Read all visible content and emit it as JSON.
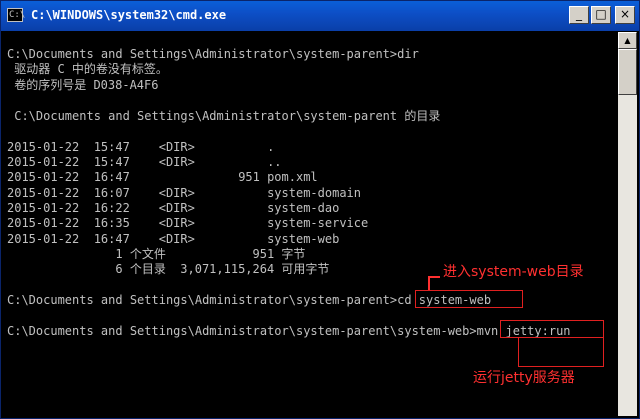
{
  "window": {
    "title": "C:\\WINDOWS\\system32\\cmd.exe",
    "icon_text": "C:\\",
    "buttons": {
      "minimize": "_",
      "maximize": "□",
      "close": "×"
    }
  },
  "console": {
    "lines": [
      "",
      "C:\\Documents and Settings\\Administrator\\system-parent>dir",
      " 驱动器 C 中的卷没有标签。",
      " 卷的序列号是 D038-A4F6",
      "",
      " C:\\Documents and Settings\\Administrator\\system-parent 的目录",
      "",
      "2015-01-22  15:47    <DIR>          .",
      "2015-01-22  15:47    <DIR>          ..",
      "2015-01-22  16:47               951 pom.xml",
      "2015-01-22  16:07    <DIR>          system-domain",
      "2015-01-22  16:22    <DIR>          system-dao",
      "2015-01-22  16:35    <DIR>          system-service",
      "2015-01-22  16:47    <DIR>          system-web",
      "               1 个文件            951 字节",
      "               6 个目录  3,071,115,264 可用字节",
      "",
      "C:\\Documents and Settings\\Administrator\\system-parent>cd system-web",
      "",
      "C:\\Documents and Settings\\Administrator\\system-parent\\system-web>mvn jetty:run"
    ]
  },
  "annotations": {
    "cd_label": "进入system-web目录",
    "run_label": "运行jetty服务器"
  },
  "colors": {
    "console_bg": "#000000",
    "console_text": "#c0c0c0",
    "annotation": "#ff3030",
    "titlebar": "#0a5fd8"
  },
  "icons": [
    "cmd-app-icon",
    "minimize-icon",
    "maximize-icon",
    "close-icon",
    "scroll-up-icon"
  ]
}
